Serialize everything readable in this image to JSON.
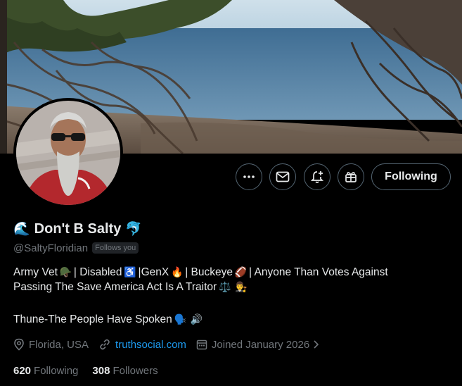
{
  "profile": {
    "display_name": "Don't B Salty",
    "name_emoji_left": "🌊",
    "name_emoji_right": "🐬",
    "handle": "@SaltyFloridian",
    "follows_you": "Follows you",
    "bio": {
      "line1": {
        "p1": "Army Vet",
        "e1": "🪖",
        "p2": "| Disabled",
        "e2": "♿",
        "p3": "|GenX",
        "e3": "🔥",
        "p4": "| Buckeye",
        "e4": "🏈",
        "p5": "| Anyone Than Votes Against"
      },
      "line2": {
        "p1": "Passing The Save America Act Is A Traitor",
        "e1": "⚖️",
        "e2": "👨‍⚖️"
      },
      "line3": {
        "p1": "Thune-The People Have Spoken",
        "e1": "🗣️",
        "e2": "🔊"
      }
    },
    "location": "Florida, USA",
    "website": "truthsocial.com",
    "joined": "Joined January 2026",
    "following_count": "620",
    "following_label": "Following",
    "followers_count": "308",
    "followers_label": "Followers"
  },
  "actions": {
    "follow_label": "Following",
    "more_icon": "more-icon",
    "message_icon": "envelope-icon",
    "notify_icon": "bell-plus-icon",
    "gift_icon": "gift-icon"
  },
  "colors": {
    "background": "#000000",
    "text": "#e7e9ea",
    "muted": "#71767b",
    "link": "#1d9bf0",
    "border": "#536471"
  }
}
